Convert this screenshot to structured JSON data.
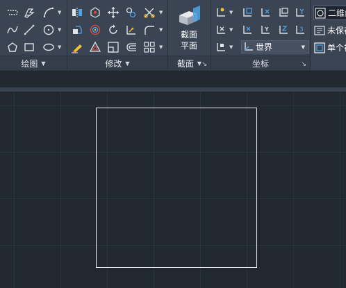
{
  "ribbon": {
    "draw_panel": {
      "title": "绘图"
    },
    "modify_panel": {
      "title": "修改"
    },
    "section_panel": {
      "title": "截面",
      "section_plane_label_line1": "截面",
      "section_plane_label_line2": "平面"
    },
    "coordinates_panel": {
      "title": "坐标",
      "ucs_select_value": "世界"
    },
    "view_panel": {
      "visual_style_value": "二维线框",
      "unsaved_view_value": "未保存的视图",
      "single_viewport_value": "单个视口"
    }
  },
  "colors": {
    "ribbon_bg": "#3b4453",
    "workspace_bg": "#212830",
    "drawn_line": "#f0f0f0",
    "accent_blue": "#4fa3e8",
    "accent_yellow": "#f2c230",
    "accent_red": "#e24b3b"
  },
  "icons": {
    "draw": [
      "polyline-icon",
      "spline-icon",
      "arc-icon",
      "line-icon",
      "circle-icon",
      "polygon-icon",
      "rectangle-icon",
      "ellipse-icon"
    ],
    "modify": [
      "mirror-icon",
      "3d-move-icon",
      "move-icon",
      "copy-icon",
      "cut-icon",
      "union-icon",
      "rotate-icon",
      "stretch-icon",
      "fillet-icon",
      "erase-icon",
      "array-icon",
      "offset-icon",
      "scale-icon",
      "grid-array-icon"
    ],
    "coordinates": [
      "ucs-icon",
      "ucs-origin-icon",
      "ucs-x-icon",
      "ucs-view-icon",
      "ucs-face-icon",
      "ucs-z-icon",
      "ucs-3point-icon",
      "ucs-named-icon"
    ]
  }
}
